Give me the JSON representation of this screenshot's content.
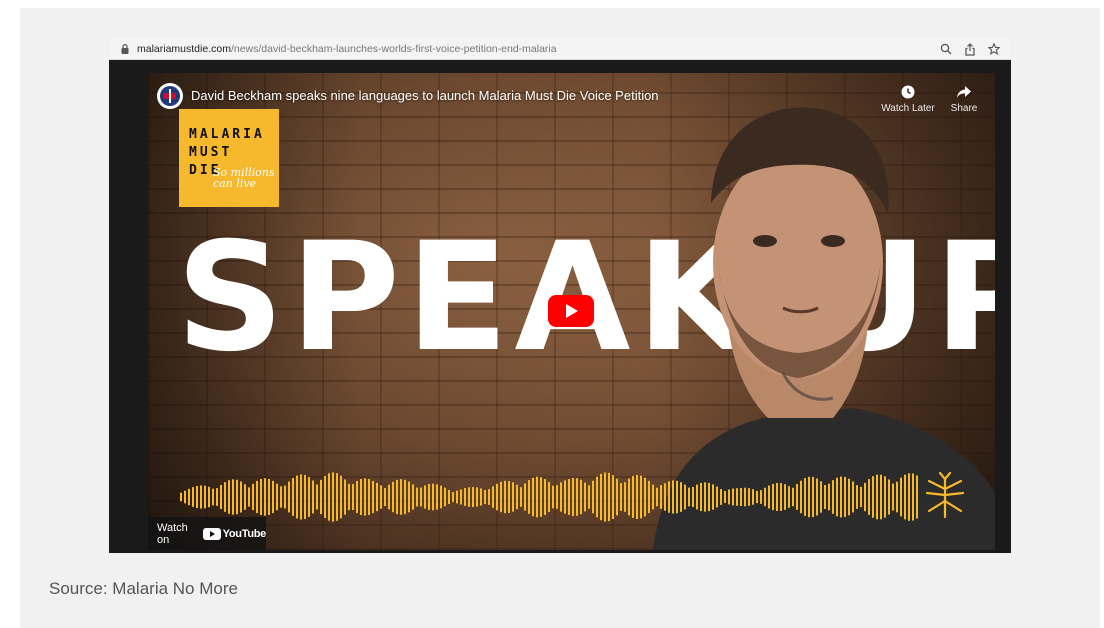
{
  "browser": {
    "url_domain": "malariamustdie.com",
    "url_path": "/news/david-beckham-launches-worlds-first-voice-petition-end-malaria",
    "icons": [
      "lock-icon",
      "zoom-icon",
      "share-icon",
      "star-icon"
    ]
  },
  "video": {
    "title": "David Beckham speaks nine languages to launch Malaria Must Die Voice Petition",
    "watch_later_label": "Watch Later",
    "share_label": "Share",
    "logo": {
      "line1": "MALARIA",
      "line2": "MUST",
      "line3": "DIE",
      "script": "So millions can live"
    },
    "headline_left": "SPEAK",
    "headline_right": "UP",
    "watch_on_label": "Watch on",
    "youtube_label": "YouTube"
  },
  "caption": "Source: Malaria No More",
  "colors": {
    "accent_yellow": "#f6b82c",
    "youtube_red": "#ff0000",
    "frame_bg": "#f1f1f1"
  }
}
